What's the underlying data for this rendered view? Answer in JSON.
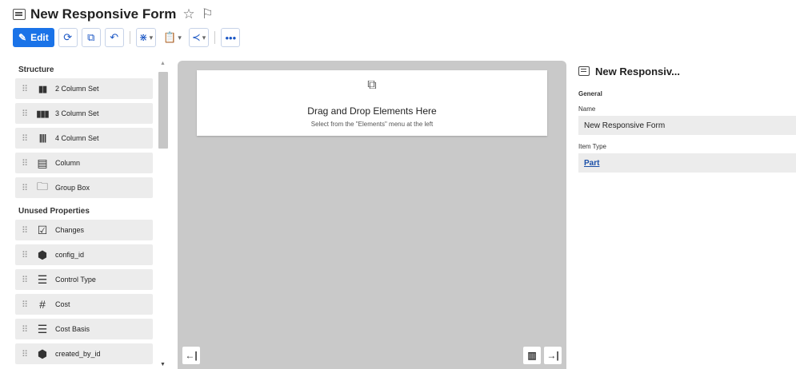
{
  "header": {
    "title": "New Responsive Form"
  },
  "toolbar": {
    "edit_label": "Edit"
  },
  "left_panel": {
    "structure_header": "Structure",
    "structure_items": [
      {
        "label": "2 Column Set",
        "icon": "two-column-icon"
      },
      {
        "label": "3 Column Set",
        "icon": "three-column-icon"
      },
      {
        "label": "4 Column Set",
        "icon": "four-column-icon"
      },
      {
        "label": "Column",
        "icon": "column-icon"
      },
      {
        "label": "Group Box",
        "icon": "folder-icon"
      }
    ],
    "unused_header": "Unused Properties",
    "unused_items": [
      {
        "label": "Changes",
        "icon": "checkbox-icon"
      },
      {
        "label": "config_id",
        "icon": "hexagon-icon"
      },
      {
        "label": "Control Type",
        "icon": "list-icon"
      },
      {
        "label": "Cost",
        "icon": "hash-icon"
      },
      {
        "label": "Cost Basis",
        "icon": "list-icon"
      },
      {
        "label": "created_by_id",
        "icon": "hexagon-icon"
      }
    ]
  },
  "canvas": {
    "drop_title": "Drag and Drop Elements Here",
    "drop_subtitle": "Select from the \"Elements\" menu at the left"
  },
  "right_panel": {
    "title": "New Responsiv...",
    "section": "General",
    "name_label": "Name",
    "name_value": "New Responsive Form",
    "item_type_label": "Item Type",
    "item_type_value": "Part"
  },
  "colors": {
    "accent": "#1a73e8",
    "canvas_bg": "#c9c9c9",
    "item_bg": "#ececec",
    "link": "#1a4fa8"
  }
}
